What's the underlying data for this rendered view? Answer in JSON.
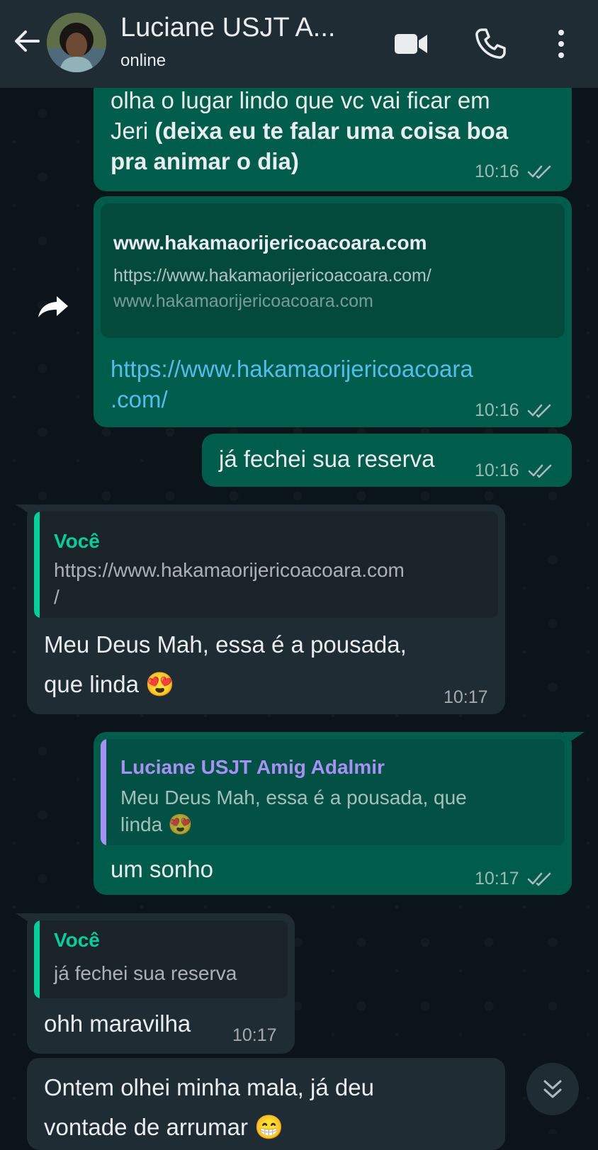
{
  "header": {
    "contact_name": "Luciane USJT A...",
    "status": "online"
  },
  "messages": [
    {
      "text_line1": "olha o lugar lindo que vc vai ficar em",
      "text_line2_normal": "Jeri ",
      "text_line2_bold": "(deixa eu te falar uma coisa boa",
      "text_line3_bold": "pra animar o dia)",
      "time": "10:16"
    },
    {
      "preview_title": "www.hakamaorijericoacoara.com",
      "preview_url": "https://www.hakamaorijericoacoara.com/",
      "preview_domain": "www.hakamaorijericoacoara.com",
      "link_line1": "https://www.hakamaorijericoacoara",
      "link_line2": ".com/",
      "time": "10:16"
    },
    {
      "text": "já fechei sua reserva",
      "time": "10:16"
    },
    {
      "quote_author": "Você",
      "quote_line1": "https://www.hakamaorijericoacoara.com",
      "quote_line2": "/",
      "text_line1": "Meu Deus Mah, essa é a pousada,",
      "text_line2": "que linda 😍",
      "time": "10:17"
    },
    {
      "quote_author": "Luciane USJT Amig Adalmir",
      "quote_line1": "Meu Deus Mah, essa é a pousada, que",
      "quote_line2": "linda 😍",
      "text": "um sonho",
      "time": "10:17"
    },
    {
      "quote_author": "Você",
      "quote_line1": "já fechei sua reserva",
      "text": "ohh maravilha",
      "time": "10:17"
    },
    {
      "text_line1": "Ontem olhei minha mala, já deu",
      "text_line2": "vontade de arrumar 😁"
    }
  ],
  "colors": {
    "header_bg": "#1f2c34",
    "chat_bg": "#0b141a",
    "outgoing_bubble": "#005c4b",
    "incoming_bubble": "#202c33",
    "link": "#53bdeb",
    "quote_you": "#06cf9c",
    "quote_contact": "#a791f3"
  },
  "icons": [
    "back-arrow-icon",
    "video-call-icon",
    "phone-icon",
    "more-vert-icon",
    "forward-icon",
    "double-check-icon",
    "chevron-double-down-icon"
  ]
}
